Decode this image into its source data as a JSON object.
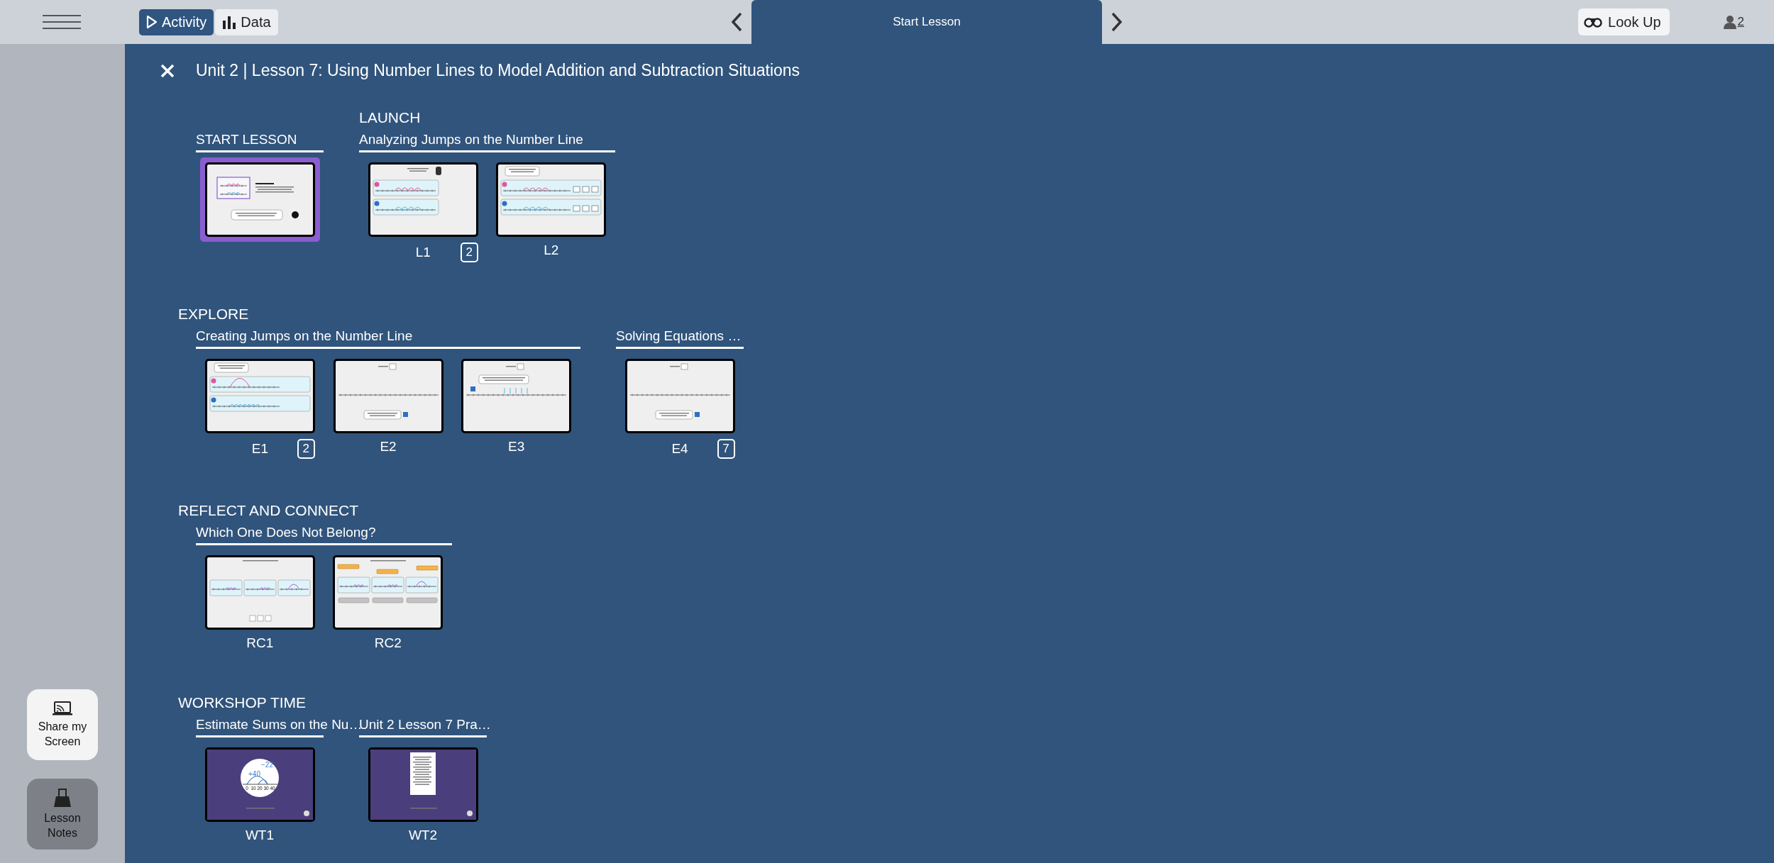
{
  "top_bar": {
    "mode_tabs": [
      {
        "label": "Activity",
        "selected": true
      },
      {
        "label": "Data",
        "selected": false
      }
    ],
    "current_tab": "Start Lesson",
    "look_up": "Look Up",
    "participants": "2"
  },
  "sidebar": {
    "buttons": [
      {
        "label": "Share my Screen",
        "kind": "light"
      },
      {
        "label": "Lesson Notes",
        "kind": "dark"
      }
    ]
  },
  "lesson": {
    "title": "Unit 2 | Lesson 7: Using Number Lines to Model Addition and Subtraction Situations",
    "rows": [
      {
        "groups": [
          {
            "title": "START LESSON",
            "items": [
              {
                "kind": "title",
                "selected": true
              }
            ]
          },
          {
            "heading": "LAUNCH",
            "title": "Analyzing Jumps on the Number Line",
            "items": [
              {
                "kind": "notice",
                "selected": false,
                "label": "L1",
                "badge": "2"
              },
              {
                "kind": "equations",
                "selected": false,
                "label": "L2"
              }
            ]
          }
        ]
      },
      {
        "heading": "EXPLORE",
        "groups": [
          {
            "title": "Creating Jumps on the Number Line",
            "items": [
              {
                "kind": "jumps",
                "selected": false,
                "label": "E1",
                "badge": "2"
              },
              {
                "kind": "single",
                "selected": false,
                "label": "E2"
              },
              {
                "kind": "mistake",
                "selected": false,
                "label": "E3"
              }
            ]
          },
          {
            "title": "Solving Equations …",
            "items": [
              {
                "kind": "single",
                "selected": false,
                "label": "E4",
                "badge": "7"
              }
            ]
          }
        ]
      },
      {
        "heading": "REFLECT AND CONNECT",
        "groups": [
          {
            "title": "Which One Does Not Belong?",
            "items": [
              {
                "kind": "wodb",
                "selected": false,
                "label": "RC1"
              },
              {
                "kind": "match",
                "selected": false,
                "label": "RC2"
              }
            ]
          }
        ]
      },
      {
        "heading": "WORKSHOP TIME",
        "groups": [
          {
            "title": "Estimate Sums on the Nu…",
            "items": [
              {
                "kind": "video",
                "selected": false,
                "label": "WT1",
                "marks": [
                  "+40",
                  "−22"
                ],
                "ticks": [
                  "0",
                  "10",
                  "20",
                  "30",
                  "40"
                ]
              }
            ]
          },
          {
            "title": "Unit 2 Lesson 7 Pra…",
            "items": [
              {
                "kind": "document",
                "selected": false,
                "label": "WT2"
              }
            ]
          }
        ]
      }
    ]
  }
}
